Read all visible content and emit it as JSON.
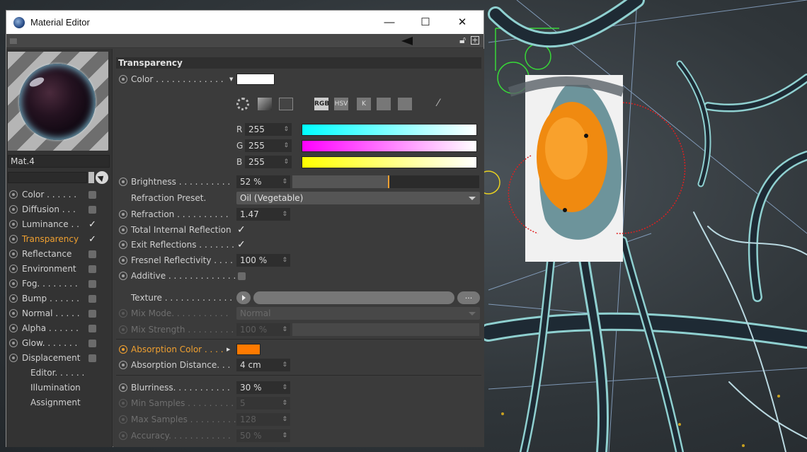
{
  "window": {
    "title": "Material Editor",
    "minimize": "—",
    "maximize": "☐",
    "close": "✕"
  },
  "material": {
    "name": "Mat.4"
  },
  "channels": [
    {
      "label": "Color . . . . . .",
      "checked": false
    },
    {
      "label": "Diffusion . . .",
      "checked": false
    },
    {
      "label": "Luminance . .",
      "checked": true
    },
    {
      "label": "Transparency",
      "checked": true,
      "active": true
    },
    {
      "label": "Reflectance",
      "checked": false
    },
    {
      "label": "Environment",
      "checked": false
    },
    {
      "label": "Fog. . . . . . . .",
      "checked": false
    },
    {
      "label": "Bump . . . . . .",
      "checked": false
    },
    {
      "label": "Normal . . . . .",
      "checked": false
    },
    {
      "label": "Alpha . . . . . .",
      "checked": false
    },
    {
      "label": "Glow. . . . . . .",
      "checked": false
    },
    {
      "label": "Displacement",
      "checked": false
    }
  ],
  "extra_items": [
    "Editor. . . . . .",
    "Illumination",
    "Assignment"
  ],
  "section_title": "Transparency",
  "color": {
    "label": "Color . . . . . . . . . . . . .",
    "swatch": "#ffffff",
    "mode_buttons": [
      "RGB",
      "HSV",
      "K"
    ],
    "r_label": "R",
    "r_value": "255",
    "g_label": "G",
    "g_value": "255",
    "b_label": "B",
    "b_value": "255"
  },
  "brightness": {
    "label": "Brightness . . . . . . . . . .",
    "value": "52 %",
    "fraction": 0.52
  },
  "refraction_preset": {
    "label": "Refraction Preset.",
    "value": "Oil (Vegetable)"
  },
  "refraction": {
    "label": "Refraction . . . . . . . . . .",
    "value": "1.47"
  },
  "total_internal_reflection": {
    "label": "Total Internal Reflection",
    "checked": true
  },
  "exit_reflections": {
    "label": "Exit Reflections . . . . . . .",
    "checked": true
  },
  "fresnel_reflectivity": {
    "label": "Fresnel Reflectivity . . . .",
    "value": "100 %"
  },
  "additive": {
    "label": "Additive . . . . . . . . . . . . .",
    "checked": false
  },
  "texture": {
    "label": "Texture . . . . . . . . . . . . .",
    "more": "..."
  },
  "mix_mode": {
    "label": "Mix Mode. . . . . . . . . . .",
    "value": "Normal"
  },
  "mix_strength": {
    "label": "Mix Strength . . . . . . . . .",
    "value": "100 %"
  },
  "absorption_color": {
    "label": "Absorption Color . . . .",
    "swatch": "#ff7a00"
  },
  "absorption_distance": {
    "label": "Absorption Distance. . .",
    "value": "4 cm"
  },
  "blurriness": {
    "label": "Blurriness. . . . . . . . . . .",
    "value": "30 %"
  },
  "min_samples": {
    "label": "Min Samples . . . . . . . . .",
    "value": "5"
  },
  "max_samples": {
    "label": "Max Samples . . . . . . . . .",
    "value": "128"
  },
  "accuracy": {
    "label": "Accuracy. . . . . . . . . . . .",
    "value": "50 %"
  },
  "colors": {
    "accent": "#f0a030",
    "panel": "#3b3b3b"
  }
}
